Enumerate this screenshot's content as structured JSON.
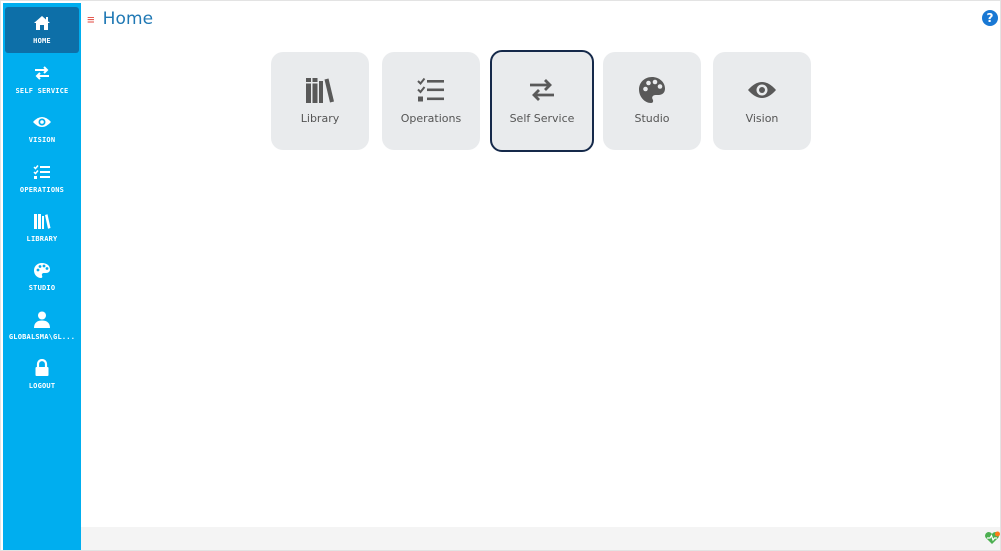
{
  "sidebar": {
    "items": [
      {
        "label": "HOME",
        "icon": "home-icon"
      },
      {
        "label": "SELF SERVICE",
        "icon": "exchange-arrows-icon"
      },
      {
        "label": "VISION",
        "icon": "eye-icon"
      },
      {
        "label": "OPERATIONS",
        "icon": "checklist-icon"
      },
      {
        "label": "LIBRARY",
        "icon": "books-icon"
      },
      {
        "label": "STUDIO",
        "icon": "palette-icon"
      },
      {
        "label": "GLOBALSMA\\GL...",
        "icon": "user-icon"
      },
      {
        "label": "LOGOUT",
        "icon": "lock-icon"
      }
    ]
  },
  "header": {
    "menu_icon": "≡",
    "title": "Home",
    "help_icon": "?"
  },
  "tiles": [
    {
      "label": "Library",
      "icon": "books-icon"
    },
    {
      "label": "Operations",
      "icon": "checklist-icon"
    },
    {
      "label": "Self Service",
      "icon": "exchange-arrows-icon"
    },
    {
      "label": "Studio",
      "icon": "palette-icon"
    },
    {
      "label": "Vision",
      "icon": "eye-icon"
    }
  ],
  "colors": {
    "sidebar": "#00aeef",
    "sidebar_active": "#0d6fa8",
    "title": "#1f78b4",
    "tile_bg": "#e9ebed",
    "selected_border": "#15294a",
    "help": "#1978d4"
  }
}
